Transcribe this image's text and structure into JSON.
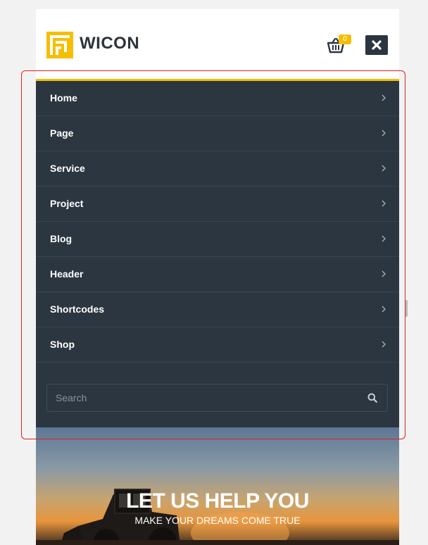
{
  "header": {
    "brand": "WICON",
    "cart_count": "0",
    "logo_color": "#f5be00"
  },
  "menu": {
    "accent": "#f5be00",
    "items": [
      {
        "label": "Home"
      },
      {
        "label": "Page"
      },
      {
        "label": "Service"
      },
      {
        "label": "Project"
      },
      {
        "label": "Blog"
      },
      {
        "label": "Header"
      },
      {
        "label": "Shortcodes"
      },
      {
        "label": "Shop"
      }
    ]
  },
  "search": {
    "placeholder": "Search",
    "value": ""
  },
  "hero": {
    "title": "LET US HELP YOU",
    "subtitle": "MAKE YOUR DREAMS COME TRUE"
  }
}
